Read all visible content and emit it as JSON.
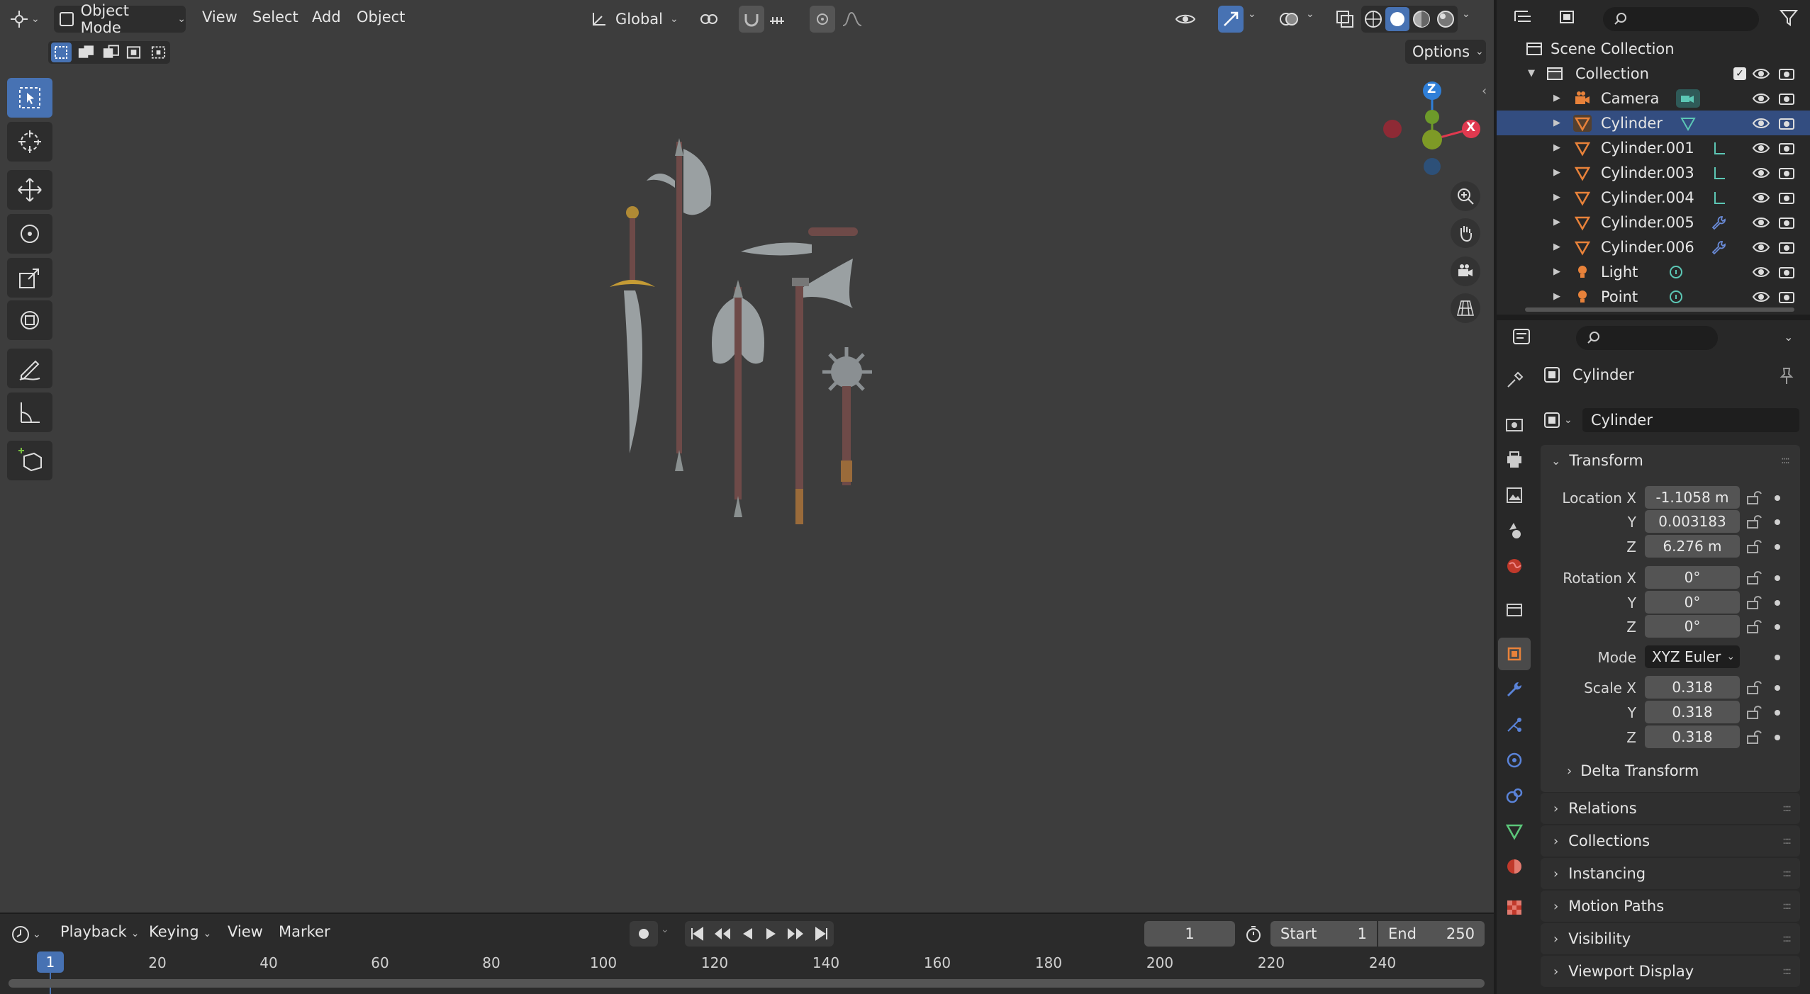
{
  "viewport_header": {
    "editor_icon": "3d-viewport-icon",
    "mode": "Object Mode",
    "menus": [
      "View",
      "Select",
      "Add",
      "Object"
    ],
    "transform_orientation": "Global",
    "options_label": "Options"
  },
  "gizmo": {
    "z_label": "Z",
    "x_label": "X",
    "colors": {
      "x": "#e0394f",
      "y": "#6d9a2a",
      "z": "#2f7fd8"
    }
  },
  "toolbar": {
    "tools": [
      "select-box-icon",
      "cursor-icon",
      "move-icon",
      "rotate-icon",
      "scale-icon",
      "transform-icon",
      "annotate-icon",
      "measure-icon",
      "add-cube-icon"
    ]
  },
  "outliner": {
    "search_placeholder": "",
    "scene_collection": "Scene Collection",
    "collection": "Collection",
    "items": [
      {
        "label": "Camera",
        "type": "camera",
        "selected": false
      },
      {
        "label": "Cylinder",
        "type": "mesh",
        "selected": true
      },
      {
        "label": "Cylinder.001",
        "type": "mesh",
        "selected": false
      },
      {
        "label": "Cylinder.003",
        "type": "mesh",
        "selected": false
      },
      {
        "label": "Cylinder.004",
        "type": "mesh",
        "selected": false
      },
      {
        "label": "Cylinder.005",
        "type": "mesh",
        "selected": false
      },
      {
        "label": "Cylinder.006",
        "type": "mesh",
        "selected": false
      },
      {
        "label": "Light",
        "type": "light",
        "selected": false
      },
      {
        "label": "Point",
        "type": "light",
        "selected": false
      }
    ]
  },
  "properties": {
    "object_name": "Cylinder",
    "object_field": "Cylinder",
    "transform": {
      "title": "Transform",
      "location_label": "Location X",
      "location": [
        "-1.1058 m",
        "0.003183",
        "6.276 m"
      ],
      "rotation_label": "Rotation X",
      "rotation": [
        "0°",
        "0°",
        "0°"
      ],
      "mode_label": "Mode",
      "mode": "XYZ Euler",
      "scale_label": "Scale X",
      "scale": [
        "0.318",
        "0.318",
        "0.318"
      ],
      "y": "Y",
      "z": "Z"
    },
    "delta_transform": "Delta Transform",
    "panels": [
      "Relations",
      "Collections",
      "Instancing",
      "Motion Paths",
      "Visibility",
      "Viewport Display"
    ],
    "accent": "#4772b3",
    "object_orange": "#e8823a"
  },
  "timeline": {
    "menus": [
      "Playback",
      "Keying",
      "View",
      "Marker"
    ],
    "current_frame": "1",
    "start_label": "Start",
    "start": "1",
    "end_label": "End",
    "end": "250",
    "playhead": "1",
    "ruler": [
      "20",
      "40",
      "60",
      "80",
      "100",
      "120",
      "140",
      "160",
      "180",
      "200",
      "220",
      "240"
    ]
  }
}
